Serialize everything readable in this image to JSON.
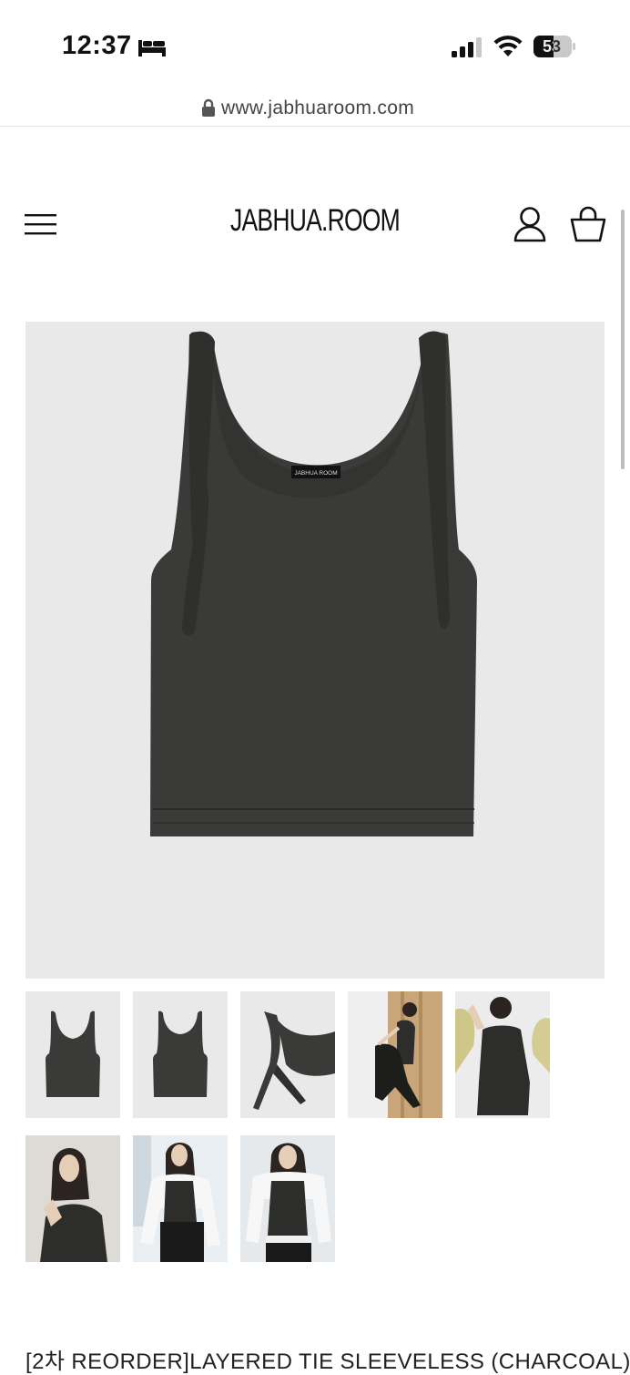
{
  "status_bar": {
    "time": "12:37",
    "battery_level": "53"
  },
  "browser": {
    "url": "www.jabhuaroom.com"
  },
  "header": {
    "logo": "JABHUA.ROOM"
  },
  "product": {
    "label_on_garment": "JABHUA ROOM",
    "title": "[2차 REORDER]LAYERED TIE SLEEVELESS  (CHARCOAL)",
    "thumbnails": [
      "thumbnail-front",
      "thumbnail-back",
      "thumbnail-tie-detail",
      "thumbnail-model-seated",
      "thumbnail-model-wall",
      "thumbnail-model-portrait",
      "thumbnail-model-jacket",
      "thumbnail-model-standing"
    ]
  },
  "colors": {
    "garment": "#3a3a38",
    "image_bg": "#e9e9e9"
  }
}
